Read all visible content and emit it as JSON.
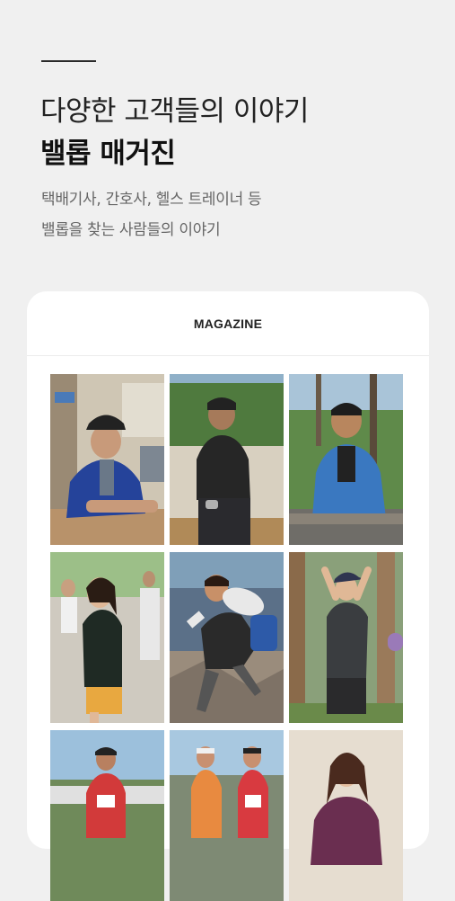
{
  "header": {
    "title_line1": "다양한 고객들의 이야기",
    "title_line2": "밸롭 매거진",
    "subtitle_line1": "택배기사, 간호사, 헬스 트레이너 등",
    "subtitle_line2": "밸롭을 찾는 사람들의 이야기"
  },
  "magazine": {
    "heading": "MAGAZINE",
    "photos": [
      {
        "name": "delivery-driver-photo"
      },
      {
        "name": "park-runner-photo"
      },
      {
        "name": "blue-vest-man-photo"
      },
      {
        "name": "woman-runner-photo"
      },
      {
        "name": "hiker-photo"
      },
      {
        "name": "cap-woman-photo"
      },
      {
        "name": "marathon-runner-photo"
      },
      {
        "name": "race-runners-photo"
      },
      {
        "name": "woman-portrait-photo"
      }
    ]
  }
}
